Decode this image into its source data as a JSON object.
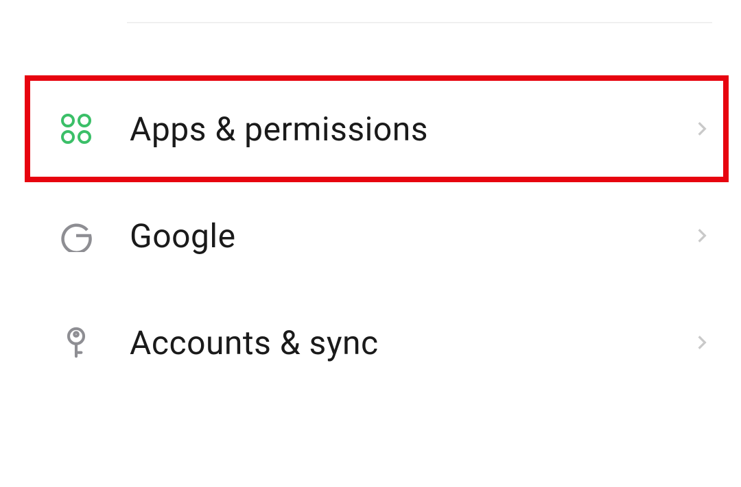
{
  "settings": {
    "items": [
      {
        "id": "apps-permissions",
        "label": "Apps & permissions",
        "highlighted": true
      },
      {
        "id": "google",
        "label": "Google",
        "highlighted": false
      },
      {
        "id": "accounts-sync",
        "label": "Accounts & sync",
        "highlighted": false
      }
    ]
  },
  "colors": {
    "icon_green": "#3bbf68",
    "icon_gray": "#8e8e93",
    "chevron": "#c9c9c9",
    "highlight": "#e7040f"
  }
}
